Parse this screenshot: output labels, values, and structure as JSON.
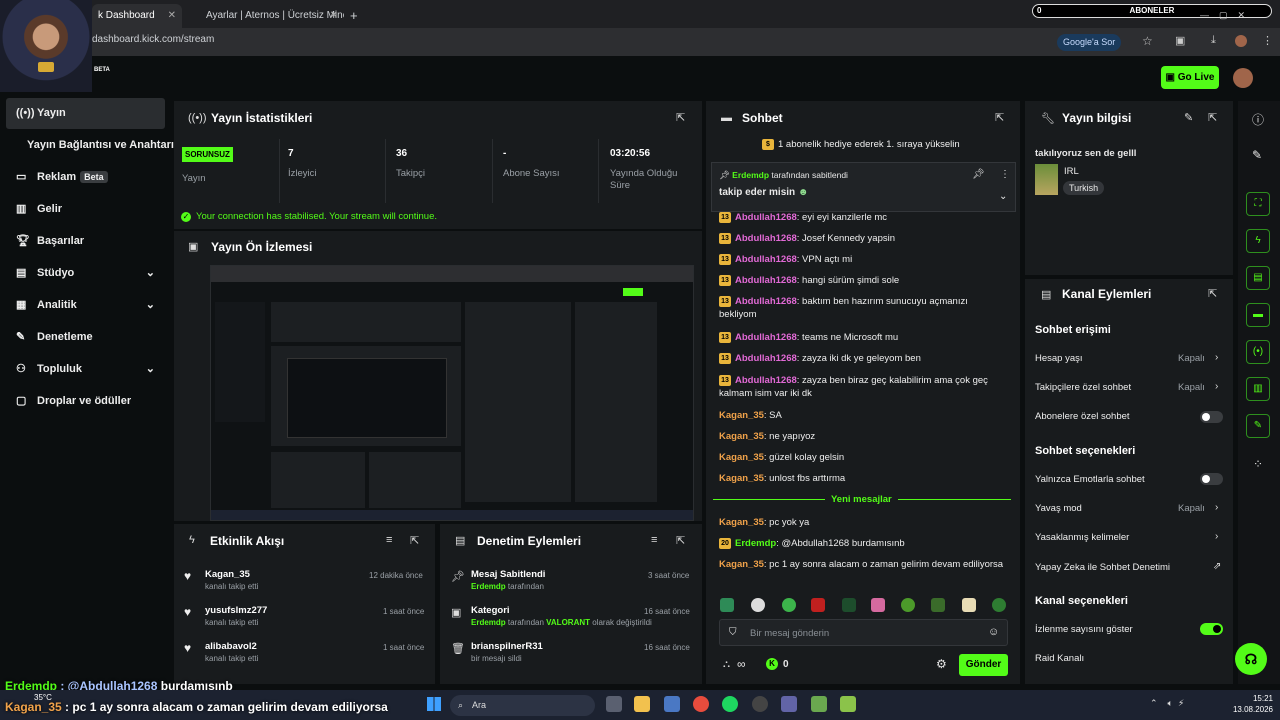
{
  "browser": {
    "tabs": [
      {
        "title": "k Dashboard",
        "active": true
      },
      {
        "title": "Ayarlar | Aternos | Ücretsiz Mine",
        "active": false
      }
    ],
    "new_tab": "+",
    "url": "dashboard.kick.com/stream",
    "google_sor": "Google'a Sor",
    "subs_bar": {
      "count": "0",
      "label": "ABONELER"
    }
  },
  "header": {
    "beta": "BETA",
    "go_live": "Go Live"
  },
  "sidebar": {
    "items": [
      {
        "label": "Yayın",
        "icon": "broadcast-icon"
      },
      {
        "label": "Yayın Bağlantısı ve Anahtarı",
        "icon": ""
      },
      {
        "label": "Reklam",
        "icon": "ad-icon",
        "badge": "Beta"
      },
      {
        "label": "Gelir",
        "icon": "revenue-icon"
      },
      {
        "label": "Başarılar",
        "icon": "trophy-icon"
      },
      {
        "label": "Stüdyo",
        "icon": "studio-icon"
      },
      {
        "label": "Analitik",
        "icon": "analytics-icon"
      },
      {
        "label": "Denetleme",
        "icon": "wrench-icon"
      },
      {
        "label": "Topluluk",
        "icon": "community-icon"
      },
      {
        "label": "Droplar ve ödüller",
        "icon": "gift-icon"
      }
    ]
  },
  "stats": {
    "title": "Yayın İstatistikleri",
    "status_badge": "SORUNSUZ",
    "status_label": "Yayın",
    "viewers": {
      "value": "7",
      "label": "İzleyici"
    },
    "followers": {
      "value": "36",
      "label": "Takipçi"
    },
    "subs": {
      "value": "-",
      "label": "Abone Sayısı"
    },
    "uptime": {
      "value": "03:20:56",
      "label": "Yayında Olduğu Süre"
    },
    "stable_msg": "Your connection has stabilised. Your stream will continue."
  },
  "preview": {
    "title": "Yayın Ön İzlemesi"
  },
  "activity": {
    "title": "Etkinlik Akışı",
    "items": [
      {
        "name": "Kagan_35",
        "sub": "kanalı takip etti",
        "time": "12 dakika önce"
      },
      {
        "name": "yusufslmz277",
        "sub": "kanalı takip etti",
        "time": "1 saat önce"
      },
      {
        "name": "alibabavol2",
        "sub": "kanalı takip etti",
        "time": "1 saat önce"
      }
    ]
  },
  "moderation": {
    "title": "Denetim Eylemleri",
    "items": [
      {
        "name": "Mesaj Sabitlendi",
        "user": "Erdemdp",
        "sub": " tarafından",
        "extra": "",
        "extra2": "",
        "time": "3 saat önce"
      },
      {
        "name": "Kategori",
        "user": "Erdemdp",
        "sub": " tarafından ",
        "extra": "VALORANT",
        "extra2": " olarak değiştirildi",
        "time": "16 saat önce"
      },
      {
        "name": "brianspilnerR31",
        "user": "",
        "sub": "bir mesajı sildi",
        "extra": "",
        "extra2": "",
        "time": "16 saat önce"
      }
    ]
  },
  "chat": {
    "title": "Sohbet",
    "gift_banner": "1 abonelik hediye ederek 1. sıraya yükselin",
    "pinned": {
      "user": "Erdemdp",
      "by": " tarafından sabitlendi",
      "message": "takip eder misin"
    },
    "messages": [
      {
        "badge": "13",
        "user": "Abdullah1268",
        "color": "pink",
        "text": ": eyi eyi kanzilerle mc"
      },
      {
        "badge": "13",
        "user": "Abdullah1268",
        "color": "pink",
        "text": ": Josef Kennedy yapsin"
      },
      {
        "badge": "13",
        "user": "Abdullah1268",
        "color": "pink",
        "text": ": VPN açtı mi"
      },
      {
        "badge": "13",
        "user": "Abdullah1268",
        "color": "pink",
        "text": ": hangi sürüm şimdi sole"
      },
      {
        "badge": "13",
        "user": "Abdullah1268",
        "color": "pink",
        "text": ": baktım ben hazırım sunucuyu açmanızı bekliyom"
      },
      {
        "badge": "13",
        "user": "Abdullah1268",
        "color": "pink",
        "text": ": teams ne Microsoft mu"
      },
      {
        "badge": "13",
        "user": "Abdullah1268",
        "color": "pink",
        "text": ": zayza iki dk ye geleyom ben"
      },
      {
        "badge": "13",
        "user": "Abdullah1268",
        "color": "pink",
        "text": ": zayza ben biraz geç kalabilirim ama çok geç kalmam isim var iki dk"
      },
      {
        "badge": "",
        "user": "Kagan_35",
        "color": "orange",
        "text": ": SA"
      },
      {
        "badge": "",
        "user": "Kagan_35",
        "color": "orange",
        "text": ": ne yapıyoz"
      },
      {
        "badge": "",
        "user": "Kagan_35",
        "color": "orange",
        "text": ": güzel kolay gelsin"
      },
      {
        "badge": "",
        "user": "Kagan_35",
        "color": "orange",
        "text": ": unlost fbs arttırma"
      }
    ],
    "new_messages_label": "Yeni mesajlar",
    "new_messages": [
      {
        "badge": "",
        "user": "Kagan_35",
        "color": "orange",
        "text": ": pc yok ya"
      },
      {
        "badge": "20",
        "user": "Erdemdp",
        "color": "green",
        "text": ": @Abdullah1268 burdamısınb"
      },
      {
        "badge": "",
        "user": "Kagan_35",
        "color": "orange",
        "text": ": pc 1 ay sonra alacam o zaman gelirim devam ediliyorsa"
      }
    ],
    "input_placeholder": "Bir mesaj gönderin",
    "points": "∞",
    "kick_count": "0",
    "send": "Gönder"
  },
  "stream_info": {
    "title": "Yayın bilgisi",
    "stream_title": "takılıyoruz sen de gelll",
    "category": "IRL",
    "tag": "Turkish"
  },
  "channel_actions": {
    "title": "Kanal Eylemleri",
    "chat_access": {
      "title": "Sohbet erişimi",
      "rows": [
        {
          "label": "Hesap yaşı",
          "value": "Kapalı"
        },
        {
          "label": "Takipçilere özel sohbet",
          "value": "Kapalı"
        },
        {
          "label": "Abonelere özel sohbet",
          "value": ""
        }
      ]
    },
    "chat_options": {
      "title": "Sohbet seçenekleri",
      "rows": [
        {
          "label": "Yalnızca Emotlarla sohbet",
          "value": ""
        },
        {
          "label": "Yavaş mod",
          "value": "Kapalı"
        },
        {
          "label": "Yasaklanmış kelimeler",
          "value": ""
        },
        {
          "label": "Yapay Zeka ile Sohbet Denetimi",
          "value": ""
        }
      ]
    },
    "channel_options": {
      "title": "Kanal seçenekleri",
      "rows": [
        {
          "label": "İzlenme sayısını göster",
          "value": ""
        },
        {
          "label": "Raid Kanalı",
          "value": ""
        }
      ]
    }
  },
  "overlay": {
    "line1_user": "Erdemdp",
    "line1_text": " : @Abdullah1268 ",
    "line1_end": "burdamısınb",
    "line2_user": "Kagan_35",
    "line2_text": " : pc 1 ay sonra alacam o zaman gelirim devam ediliyorsa"
  },
  "taskbar": {
    "weather": "35°C",
    "search": "Ara",
    "time": "15:21",
    "date": "13.08.2026"
  },
  "colors": {
    "accent": "#53fc18",
    "pink": "#e26ad6",
    "orange": "#f0a24a",
    "gold": "#e9b53b"
  }
}
